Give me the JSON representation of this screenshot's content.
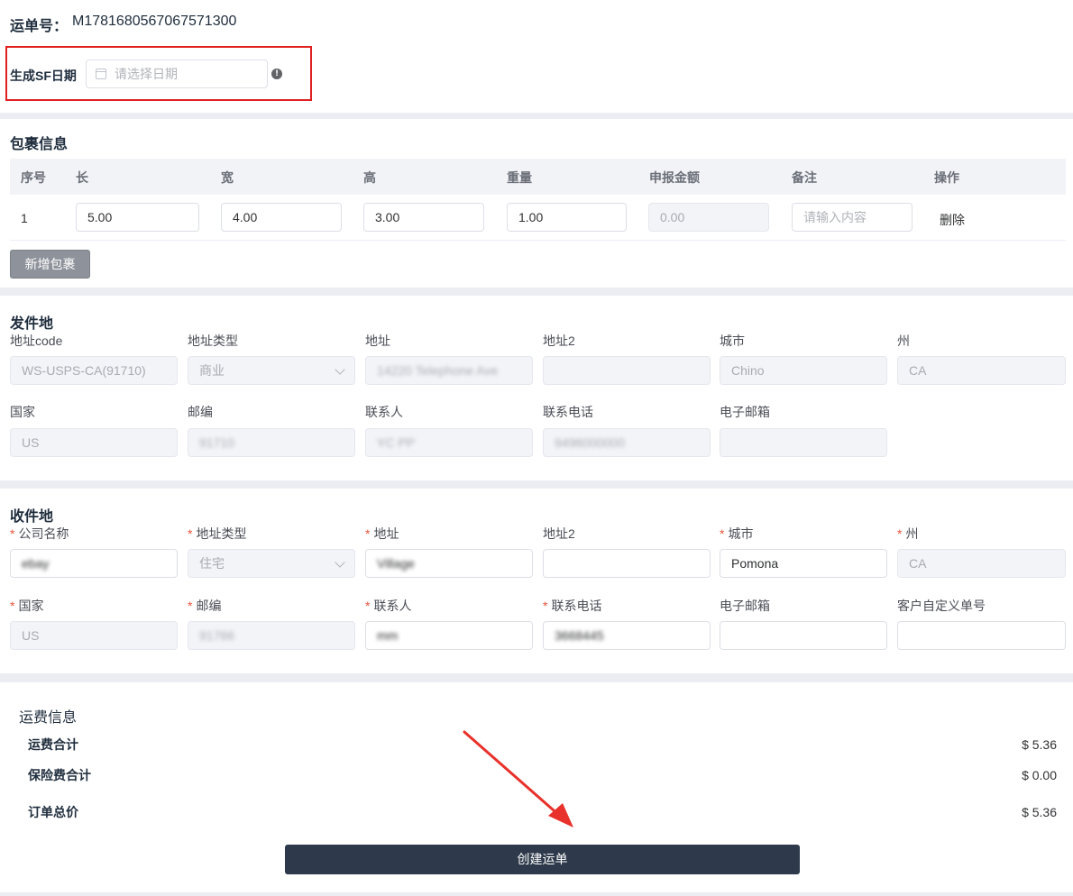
{
  "order": {
    "label": "运单号：",
    "number": "M1781680567067571300"
  },
  "sf_date": {
    "label": "生成SF日期",
    "placeholder": "请选择日期",
    "icon": "calendar-icon",
    "info_icon": "info-icon"
  },
  "package": {
    "title": "包裹信息",
    "columns": [
      "序号",
      "长",
      "宽",
      "高",
      "重量",
      "申报金额",
      "备注",
      "操作"
    ],
    "rows": [
      {
        "index": "1",
        "length": "5.00",
        "width": "4.00",
        "height": "3.00",
        "weight": "1.00",
        "declared": "0.00",
        "remark_placeholder": "请输入内容",
        "action": "删除"
      }
    ],
    "add_button": "新增包裹"
  },
  "sender": {
    "title": "发件地",
    "fields": [
      {
        "label": "地址code",
        "value": "WS-USPS-CA(91710)"
      },
      {
        "label": "地址类型",
        "value": "商业"
      },
      {
        "label": "地址",
        "value": "14220 Telephone Ave"
      },
      {
        "label": "地址2",
        "value": ""
      },
      {
        "label": "城市",
        "value": "Chino"
      },
      {
        "label": "州",
        "value": "CA"
      },
      {
        "label": "国家",
        "value": "US"
      },
      {
        "label": "邮编",
        "value": "91710"
      },
      {
        "label": "联系人",
        "value": "YC PP"
      },
      {
        "label": "联系电话",
        "value": "9496000000"
      },
      {
        "label": "电子邮箱",
        "value": ""
      }
    ]
  },
  "receiver": {
    "title": "收件地",
    "fields": [
      {
        "label": "公司名称",
        "required": "*",
        "value": "ebay"
      },
      {
        "label": "地址类型",
        "required": "*",
        "value": "住宅"
      },
      {
        "label": "地址",
        "required": "*",
        "value": "Village"
      },
      {
        "label": "地址2",
        "required": "",
        "value": ""
      },
      {
        "label": "城市",
        "required": "*",
        "value": "Pomona"
      },
      {
        "label": "州",
        "required": "*",
        "value": "CA"
      },
      {
        "label": "国家",
        "required": "*",
        "value": "US"
      },
      {
        "label": "邮编",
        "required": "*",
        "value": "91766"
      },
      {
        "label": "联系人",
        "required": "*",
        "value": "mm"
      },
      {
        "label": "联系电话",
        "required": "*",
        "value": "3668445"
      },
      {
        "label": "电子邮箱",
        "required": "",
        "value": ""
      },
      {
        "label": "客户自定义单号",
        "required": "",
        "value": ""
      }
    ]
  },
  "fees": {
    "title": "运费信息",
    "items": [
      {
        "label": "运费合计",
        "value": "$ 5.36"
      },
      {
        "label": "保险费合计",
        "value": "$ 0.00"
      },
      {
        "label": "订单总价",
        "value": "$ 5.36"
      }
    ],
    "create_button": "创建运单"
  },
  "colors": {
    "highlight_box": "#e02020",
    "annotation_arrow": "#e8312a",
    "primary_button": "#2e3a4b",
    "required_star": "#e8553f"
  }
}
